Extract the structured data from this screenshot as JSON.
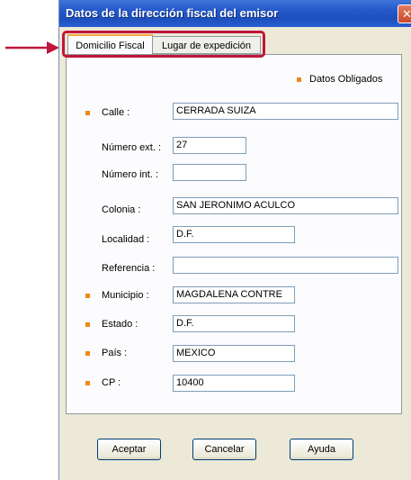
{
  "window": {
    "title": "Datos de la dirección fiscal del emisor",
    "close_symbol": "✕"
  },
  "tabs": [
    {
      "label": "Domicilio Fiscal",
      "active": true
    },
    {
      "label": "Lugar de expedición",
      "active": false
    }
  ],
  "legend": {
    "label": "Datos Obligados"
  },
  "form": {
    "calle": {
      "label": "Calle :",
      "value": "CERRADA SUIZA",
      "required": true
    },
    "numero_ext": {
      "label": "Número ext. :",
      "value": "27",
      "required": false
    },
    "numero_int": {
      "label": "Número int. :",
      "value": "",
      "required": false
    },
    "colonia": {
      "label": "Colonia :",
      "value": "SAN JERONIMO ACULCO",
      "required": false
    },
    "localidad": {
      "label": "Localidad :",
      "value": "D.F.",
      "required": false
    },
    "referencia": {
      "label": "Referencia :",
      "value": "",
      "required": false
    },
    "municipio": {
      "label": "Municipio :",
      "value": "MAGDALENA CONTRE",
      "required": true
    },
    "estado": {
      "label": "Estado :",
      "value": "D.F.",
      "required": true
    },
    "pais": {
      "label": "País :",
      "value": "MEXICO",
      "required": true
    },
    "cp": {
      "label": "CP :",
      "value": "10400",
      "required": true
    }
  },
  "buttons": {
    "aceptar": "Aceptar",
    "cancelar": "Cancelar",
    "ayuda": "Ayuda"
  },
  "colors": {
    "titlebar": "#2457c9",
    "required_marker": "#ee8a16",
    "annotation": "#c0163a"
  },
  "icons": {
    "annotation_arrow": "arrow-right-icon",
    "close": "close-icon",
    "required_marker": "required-dot-icon"
  }
}
